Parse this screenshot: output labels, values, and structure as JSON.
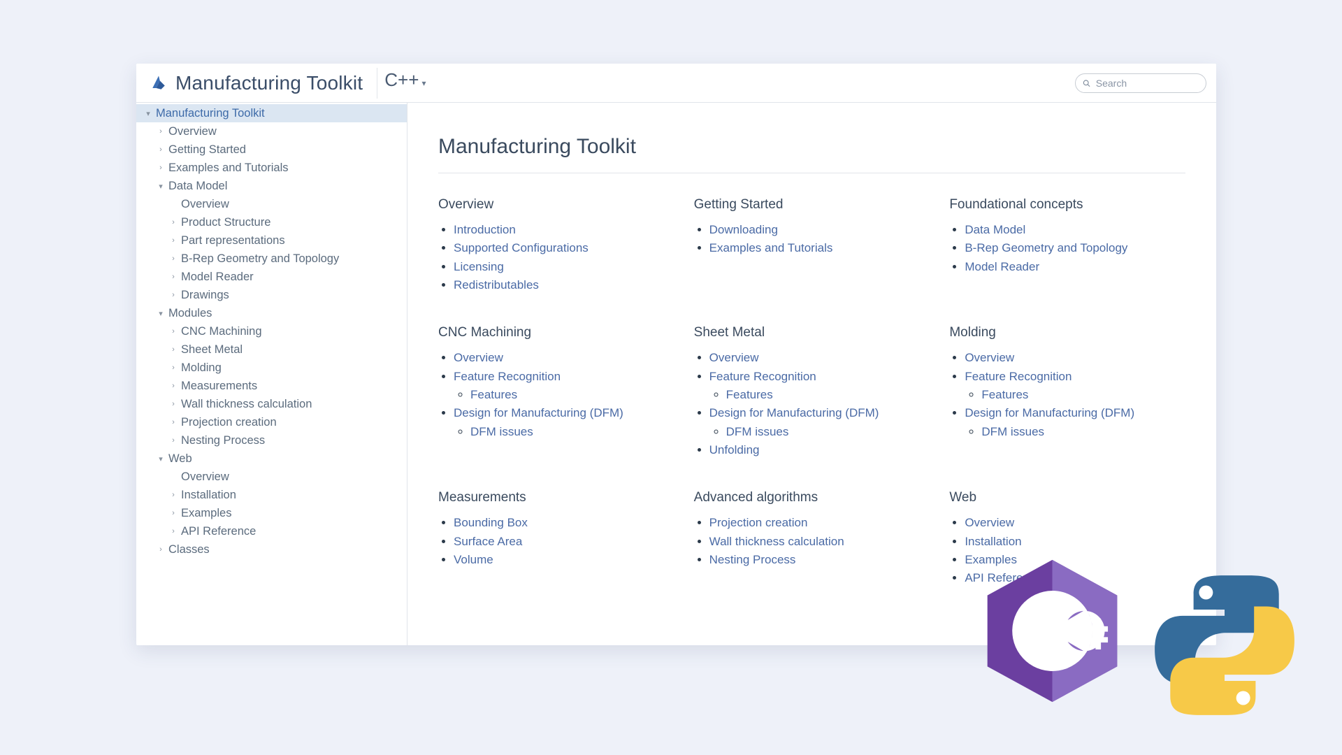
{
  "header": {
    "product_name": "Manufacturing Toolkit",
    "language_label": "C++",
    "search_placeholder": "Search"
  },
  "nav": [
    {
      "depth": 0,
      "caret": "down",
      "label": "Manufacturing Toolkit",
      "active": true
    },
    {
      "depth": 1,
      "caret": "right",
      "label": "Overview"
    },
    {
      "depth": 1,
      "caret": "right",
      "label": "Getting Started"
    },
    {
      "depth": 1,
      "caret": "right",
      "label": "Examples and Tutorials"
    },
    {
      "depth": 1,
      "caret": "down",
      "label": "Data Model"
    },
    {
      "depth": 2,
      "caret": "",
      "label": "Overview"
    },
    {
      "depth": 2,
      "caret": "right",
      "label": "Product Structure"
    },
    {
      "depth": 2,
      "caret": "right",
      "label": "Part representations"
    },
    {
      "depth": 2,
      "caret": "right",
      "label": "B-Rep Geometry and Topology"
    },
    {
      "depth": 2,
      "caret": "right",
      "label": "Model Reader"
    },
    {
      "depth": 2,
      "caret": "right",
      "label": "Drawings"
    },
    {
      "depth": 1,
      "caret": "down",
      "label": "Modules"
    },
    {
      "depth": 2,
      "caret": "right",
      "label": "CNC Machining"
    },
    {
      "depth": 2,
      "caret": "right",
      "label": "Sheet Metal"
    },
    {
      "depth": 2,
      "caret": "right",
      "label": "Molding"
    },
    {
      "depth": 2,
      "caret": "right",
      "label": "Measurements"
    },
    {
      "depth": 2,
      "caret": "right",
      "label": "Wall thickness calculation"
    },
    {
      "depth": 2,
      "caret": "right",
      "label": "Projection creation"
    },
    {
      "depth": 2,
      "caret": "right",
      "label": "Nesting Process"
    },
    {
      "depth": 1,
      "caret": "down",
      "label": "Web"
    },
    {
      "depth": 2,
      "caret": "",
      "label": "Overview"
    },
    {
      "depth": 2,
      "caret": "right",
      "label": "Installation"
    },
    {
      "depth": 2,
      "caret": "right",
      "label": "Examples"
    },
    {
      "depth": 2,
      "caret": "right",
      "label": "API Reference"
    },
    {
      "depth": 1,
      "caret": "right",
      "label": "Classes"
    }
  ],
  "page": {
    "title": "Manufacturing Toolkit",
    "sections": [
      {
        "heading": "Overview",
        "links": [
          {
            "text": "Introduction"
          },
          {
            "text": "Supported Configurations"
          },
          {
            "text": "Licensing"
          },
          {
            "text": "Redistributables"
          }
        ]
      },
      {
        "heading": "Getting Started",
        "links": [
          {
            "text": "Downloading"
          },
          {
            "text": "Examples and Tutorials"
          }
        ]
      },
      {
        "heading": "Foundational concepts",
        "links": [
          {
            "text": "Data Model"
          },
          {
            "text": "B-Rep Geometry and Topology"
          },
          {
            "text": "Model Reader"
          }
        ]
      },
      {
        "heading": "CNC Machining",
        "links": [
          {
            "text": "Overview"
          },
          {
            "text": "Feature Recognition",
            "children": [
              {
                "text": "Features"
              }
            ]
          },
          {
            "text": "Design for Manufacturing (DFM)",
            "children": [
              {
                "text": "DFM issues"
              }
            ]
          }
        ]
      },
      {
        "heading": "Sheet Metal",
        "links": [
          {
            "text": "Overview"
          },
          {
            "text": "Feature Recognition",
            "children": [
              {
                "text": "Features"
              }
            ]
          },
          {
            "text": "Design for Manufacturing (DFM)",
            "children": [
              {
                "text": "DFM issues"
              }
            ]
          },
          {
            "text": "Unfolding"
          }
        ]
      },
      {
        "heading": "Molding",
        "links": [
          {
            "text": "Overview"
          },
          {
            "text": "Feature Recognition",
            "children": [
              {
                "text": "Features"
              }
            ]
          },
          {
            "text": "Design for Manufacturing (DFM)",
            "children": [
              {
                "text": "DFM issues"
              }
            ]
          }
        ]
      },
      {
        "heading": "Measurements",
        "links": [
          {
            "text": "Bounding Box"
          },
          {
            "text": "Surface Area"
          },
          {
            "text": "Volume"
          }
        ]
      },
      {
        "heading": "Advanced algorithms",
        "links": [
          {
            "text": "Projection creation"
          },
          {
            "text": "Wall thickness calculation"
          },
          {
            "text": "Nesting Process"
          }
        ]
      },
      {
        "heading": "Web",
        "links": [
          {
            "text": "Overview"
          },
          {
            "text": "Installation"
          },
          {
            "text": "Examples"
          },
          {
            "text": "API Reference"
          }
        ]
      }
    ]
  }
}
